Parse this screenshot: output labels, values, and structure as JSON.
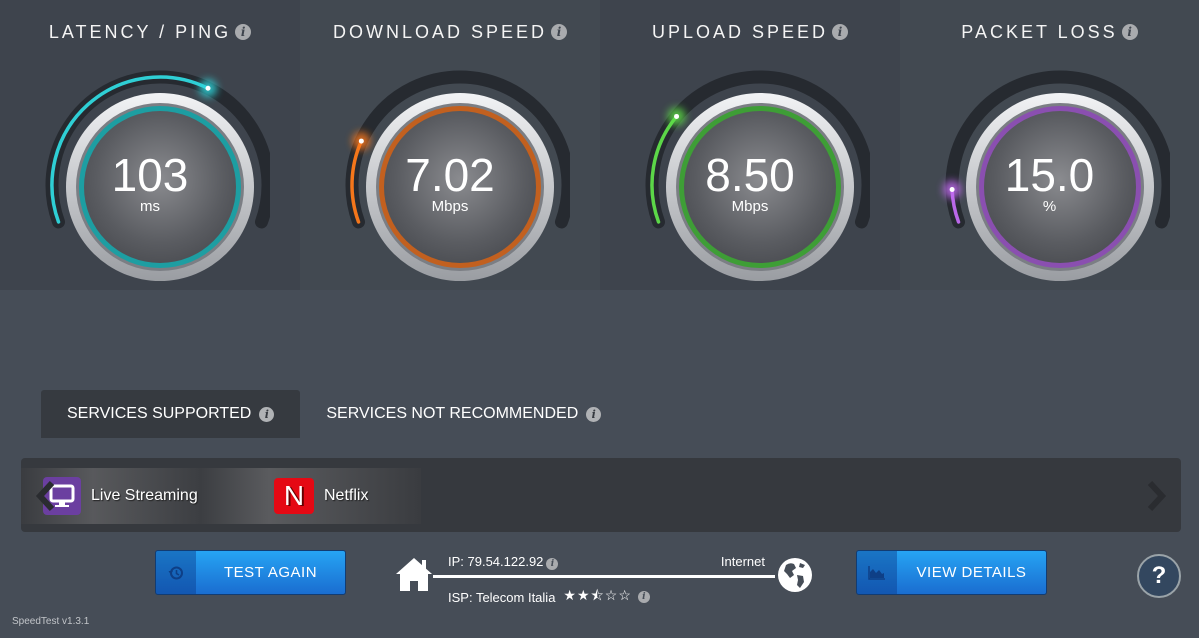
{
  "gauges": [
    {
      "id": "latency",
      "title": "LATENCY / PING",
      "value": "103",
      "unit": "ms",
      "fill_fraction": 0.62,
      "color": "#2fd8de",
      "ring": "#1d9ea2"
    },
    {
      "id": "download",
      "title": "DOWNLOAD SPEED",
      "value": "7.02",
      "unit": "Mbps",
      "fill_fraction": 0.2,
      "color": "#ff7a1a",
      "ring": "#c2601f"
    },
    {
      "id": "upload",
      "title": "UPLOAD SPEED",
      "value": "8.50",
      "unit": "Mbps",
      "fill_fraction": 0.27,
      "color": "#5fe04a",
      "ring": "#3e9e36"
    },
    {
      "id": "packet_loss",
      "title": "PACKET LOSS",
      "value": "15.0",
      "unit": "%",
      "fill_fraction": 0.08,
      "color": "#c26cf2",
      "ring": "#8a4fb0"
    }
  ],
  "info_glyph": "i",
  "tabs": [
    {
      "label": "SERVICES SUPPORTED",
      "active": true
    },
    {
      "label": "SERVICES NOT RECOMMENDED",
      "active": false
    }
  ],
  "services": [
    {
      "name": "Live Streaming",
      "icon": "tv-icon",
      "color": "#6b3fa0"
    },
    {
      "name": "Netflix",
      "icon": "netflix-icon",
      "glyph": "N",
      "color": "#e50914"
    }
  ],
  "buttons": {
    "test_again": "TEST AGAIN",
    "view_details": "VIEW DETAILS"
  },
  "connection": {
    "ip": "IP: 79.54.122.92",
    "isp": "ISP: Telecom Italia",
    "rating": 2.5,
    "rating_max": 5,
    "stars_display": "★★⯪☆☆",
    "internet_label": "Internet"
  },
  "help_label": "?",
  "version": "SpeedTest v1.3.1"
}
